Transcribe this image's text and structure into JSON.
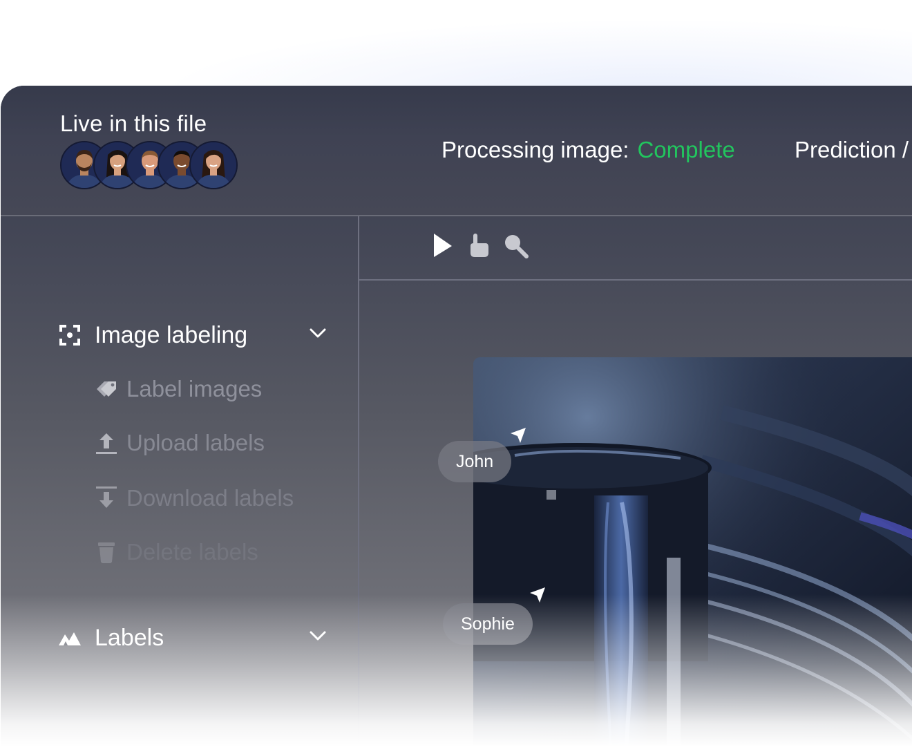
{
  "header": {
    "live_title": "Live in this file",
    "avatars": [
      {
        "name": "avatar-1",
        "skin": "#b9855f",
        "hair": "#3a2417"
      },
      {
        "name": "avatar-2",
        "skin": "#d7a17e",
        "hair": "#1b1310"
      },
      {
        "name": "avatar-3",
        "skin": "#d99a7a",
        "hair": "#8a5a36"
      },
      {
        "name": "avatar-4",
        "skin": "#7a4b2f",
        "hair": "#120c08"
      },
      {
        "name": "avatar-5",
        "skin": "#d9a283",
        "hair": "#2a1810"
      }
    ],
    "processing_label": "Processing image:",
    "processing_status": "Complete",
    "prediction_label": "Prediction /"
  },
  "colors": {
    "status_complete": "#22c55e",
    "dim_text": "#8f919c"
  },
  "sidebar": {
    "image_labeling": {
      "label": "Image labeling",
      "icon": "focus-frame-icon",
      "items": [
        {
          "label": "Label images",
          "icon": "tag-icon"
        },
        {
          "label": "Upload labels",
          "icon": "upload-icon"
        },
        {
          "label": "Download labels",
          "icon": "download-icon"
        },
        {
          "label": "Delete labels",
          "icon": "trash-icon"
        }
      ]
    },
    "labels": {
      "label": "Labels",
      "icon": "mountain-icon"
    }
  },
  "toolbar": {
    "tools": [
      {
        "name": "pointer-tool",
        "icon": "arrow-pointer-icon"
      },
      {
        "name": "hand-tool",
        "icon": "hand-pointer-icon"
      },
      {
        "name": "zoom-tool",
        "icon": "magnifier-icon"
      }
    ]
  },
  "collaborators": {
    "john": "John",
    "sophie": "Sophie"
  }
}
